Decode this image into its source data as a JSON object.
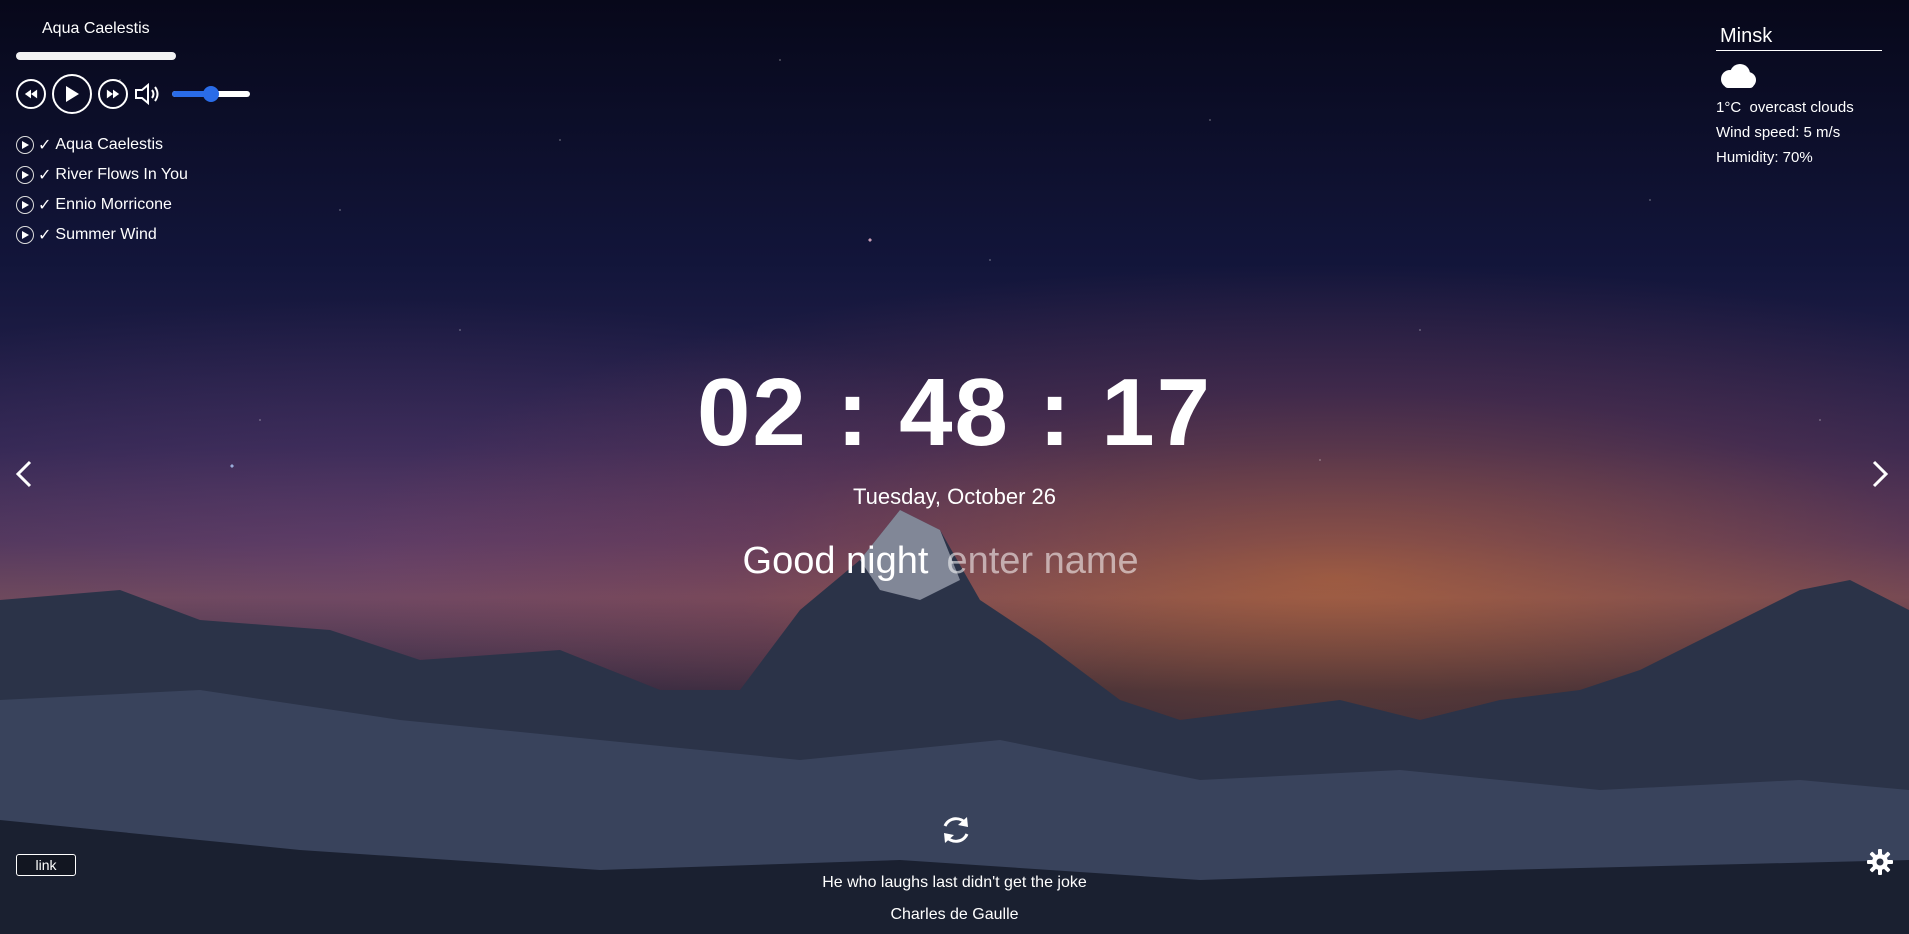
{
  "player": {
    "now_playing": "Aqua Caelestis",
    "volume_level": 0.5,
    "controls": {
      "prev_icon": "rewind-icon",
      "play_icon": "play-icon",
      "next_icon": "fast-forward-icon",
      "volume_icon": "volume-icon"
    },
    "playlist": [
      {
        "title": "Aqua Caelestis",
        "check": "✓"
      },
      {
        "title": "River Flows In You",
        "check": "✓"
      },
      {
        "title": "Ennio Morricone",
        "check": "✓"
      },
      {
        "title": "Summer Wind",
        "check": "✓"
      }
    ]
  },
  "weather": {
    "city": "Minsk",
    "icon": "cloud-icon",
    "temperature": "1°C",
    "description": "overcast clouds",
    "wind": "Wind speed: 5 m/s",
    "humidity": "Humidity: 70%"
  },
  "clock": {
    "time": "02 : 48 : 17",
    "date": "Tuesday, October 26"
  },
  "greeting": {
    "text": "Good night",
    "name_placeholder": "enter name"
  },
  "quote": {
    "text": "He who laughs last didn't get the joke",
    "author": "Charles de Gaulle"
  },
  "footer": {
    "link_label": "link"
  },
  "colors": {
    "accent": "#2a6ce8",
    "text": "#ffffff"
  }
}
